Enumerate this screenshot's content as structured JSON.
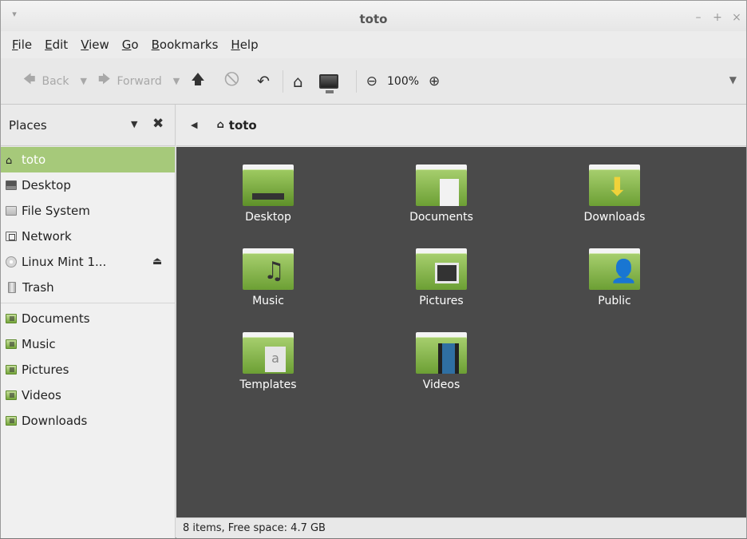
{
  "window": {
    "title": "toto",
    "menu_glyph": "▾",
    "minimize": "–",
    "maximize": "+",
    "close": "×"
  },
  "menubar": {
    "items": [
      {
        "u": "F",
        "rest": "ile"
      },
      {
        "u": "E",
        "rest": "dit"
      },
      {
        "u": "V",
        "rest": "iew"
      },
      {
        "u": "G",
        "rest": "o"
      },
      {
        "u": "B",
        "rest": "ookmarks"
      },
      {
        "u": "H",
        "rest": "elp"
      }
    ]
  },
  "toolbar": {
    "back_label": "Back",
    "forward_label": "Forward",
    "zoom_level": "100%",
    "overflow": "▼"
  },
  "sidebar": {
    "header": "Places",
    "items": [
      {
        "label": "toto",
        "icon": "home-icon"
      },
      {
        "label": "Desktop",
        "icon": "desktop-icon"
      },
      {
        "label": "File System",
        "icon": "filesystem-icon"
      },
      {
        "label": "Network",
        "icon": "network-icon"
      },
      {
        "label": "Linux Mint 1...",
        "icon": "disc-icon"
      },
      {
        "label": "Trash",
        "icon": "trash-icon"
      },
      {
        "label": "Documents",
        "icon": "folder-icon"
      },
      {
        "label": "Music",
        "icon": "folder-icon"
      },
      {
        "label": "Pictures",
        "icon": "folder-icon"
      },
      {
        "label": "Videos",
        "icon": "folder-icon"
      },
      {
        "label": "Downloads",
        "icon": "folder-icon"
      }
    ]
  },
  "pathbar": {
    "crumb": "toto"
  },
  "files": [
    {
      "label": "Desktop",
      "emblem": "desktop"
    },
    {
      "label": "Documents",
      "emblem": "document"
    },
    {
      "label": "Downloads",
      "emblem": "download"
    },
    {
      "label": "Music",
      "emblem": "music"
    },
    {
      "label": "Pictures",
      "emblem": "picture"
    },
    {
      "label": "Public",
      "emblem": "person"
    },
    {
      "label": "Templates",
      "emblem": "template"
    },
    {
      "label": "Videos",
      "emblem": "video"
    }
  ],
  "status": {
    "text": "8 items, Free space: 4.7 GB"
  },
  "colors": {
    "accent": "#a6c97a",
    "content_bg": "#4a4a4a",
    "folder": "#8cbd53"
  }
}
